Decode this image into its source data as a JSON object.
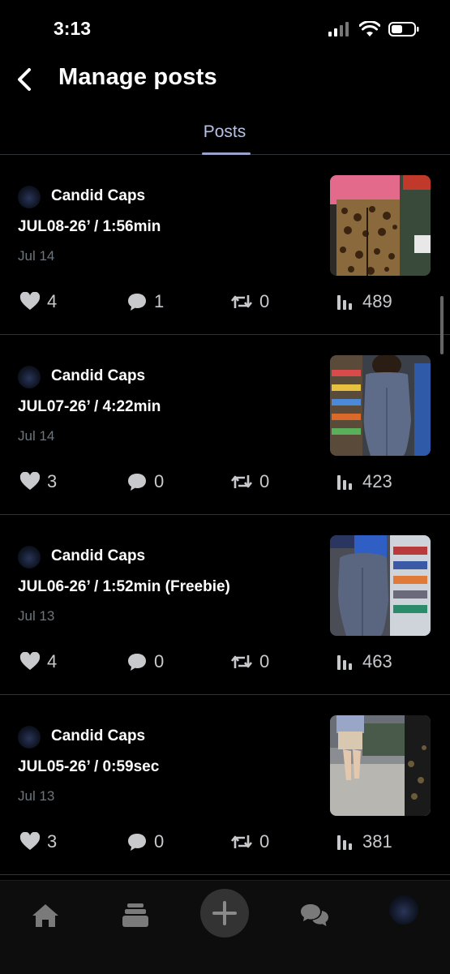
{
  "status_bar": {
    "time": "3:13"
  },
  "header": {
    "title": "Manage posts"
  },
  "tabs": [
    {
      "label": "Posts",
      "active": true
    }
  ],
  "posts": [
    {
      "author": "Candid Caps",
      "title": "JUL08-26’ / 1:56min",
      "date": "Jul 14",
      "likes": "4",
      "replies": "1",
      "reposts": "0",
      "views": "489"
    },
    {
      "author": "Candid Caps",
      "title": "JUL07-26’ / 4:22min",
      "date": "Jul 14",
      "likes": "3",
      "replies": "0",
      "reposts": "0",
      "views": "423"
    },
    {
      "author": "Candid Caps",
      "title": "JUL06-26’ / 1:52min (Freebie)",
      "date": "Jul 13",
      "likes": "4",
      "replies": "0",
      "reposts": "0",
      "views": "463"
    },
    {
      "author": "Candid Caps",
      "title": "JUL05-26’ / 0:59sec",
      "date": "Jul 13",
      "likes": "3",
      "replies": "0",
      "reposts": "0",
      "views": "381"
    }
  ],
  "bottom_nav": {
    "items": [
      "home-icon",
      "feed-icon",
      "compose-icon",
      "messages-icon",
      "profile-avatar"
    ]
  },
  "colors": {
    "background": "#000000",
    "tab_active": "#b8c0e6",
    "muted": "#6e767d",
    "divider": "#2f3336"
  }
}
